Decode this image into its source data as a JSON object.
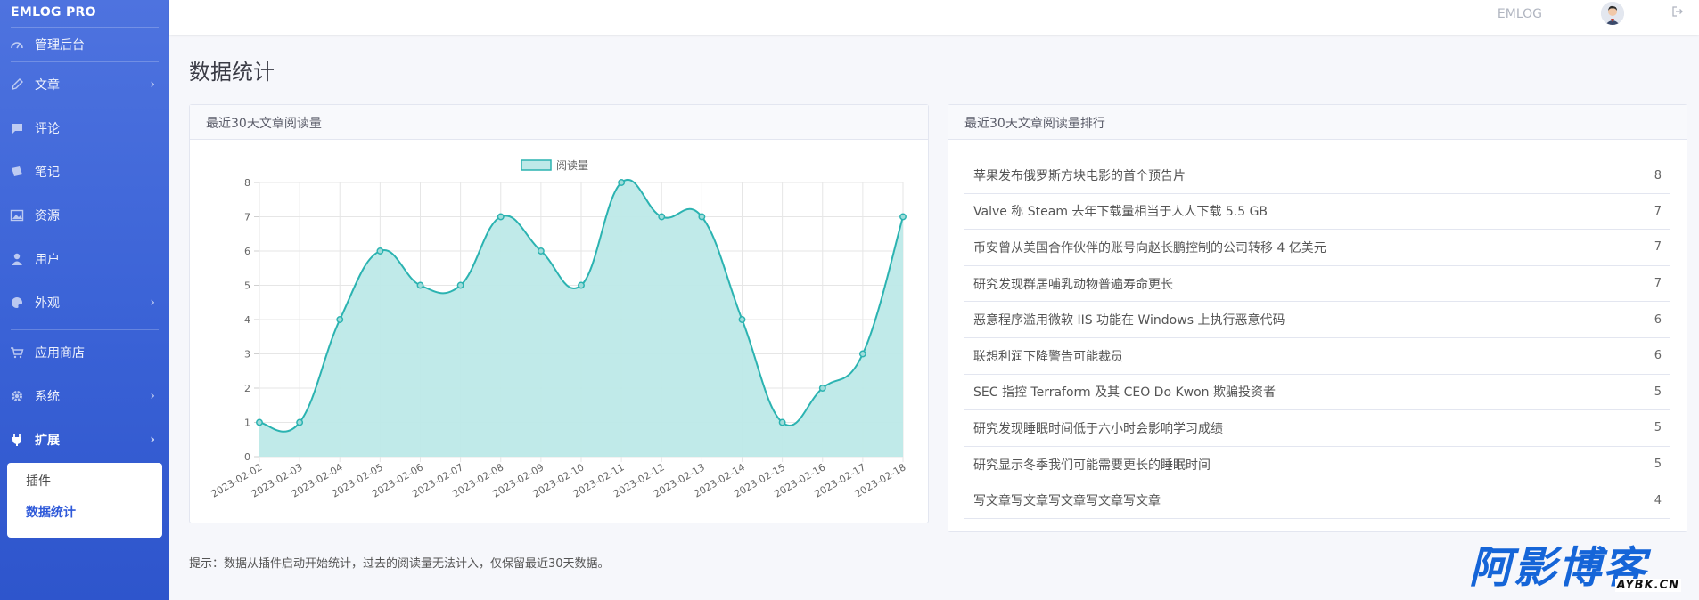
{
  "app": {
    "brand": "EMLOG PRO",
    "site_name": "EMLOG"
  },
  "sidebar": {
    "items": [
      {
        "label": "管理后台",
        "icon": "dashboard-icon",
        "chevron": false,
        "bold": false
      },
      {
        "label": "文章",
        "icon": "pencil-icon",
        "chevron": true,
        "bold": false
      },
      {
        "label": "评论",
        "icon": "comment-icon",
        "chevron": false,
        "bold": false
      },
      {
        "label": "笔记",
        "icon": "sticky-note-icon",
        "chevron": false,
        "bold": false
      },
      {
        "label": "资源",
        "icon": "image-icon",
        "chevron": false,
        "bold": false
      },
      {
        "label": "用户",
        "icon": "user-icon",
        "chevron": false,
        "bold": false
      },
      {
        "label": "外观",
        "icon": "palette-icon",
        "chevron": true,
        "bold": false
      },
      {
        "label": "应用商店",
        "icon": "store-icon",
        "chevron": false,
        "bold": false
      },
      {
        "label": "系统",
        "icon": "gear-icon",
        "chevron": true,
        "bold": false
      },
      {
        "label": "扩展",
        "icon": "plug-icon",
        "chevron": true,
        "bold": true
      }
    ],
    "submenu": [
      {
        "label": "插件",
        "active": false
      },
      {
        "label": "数据统计",
        "active": true
      }
    ]
  },
  "main": {
    "title": "数据统计",
    "chart_card_title": "最近30天文章阅读量",
    "ranking_card_title": "最近30天文章阅读量排行",
    "tip": "提示：数据从插件启动开始统计，过去的阅读量无法计入，仅保留最近30天数据。"
  },
  "ranking": [
    {
      "title": "苹果发布俄罗斯方块电影的首个预告片",
      "count": "8"
    },
    {
      "title": "Valve 称 Steam 去年下载量相当于人人下载 5.5 GB",
      "count": "7"
    },
    {
      "title": "币安曾从美国合作伙伴的账号向赵长鹏控制的公司转移 4 亿美元",
      "count": "7"
    },
    {
      "title": "研究发现群居哺乳动物普遍寿命更长",
      "count": "7"
    },
    {
      "title": "恶意程序滥用微软 IIS 功能在 Windows 上执行恶意代码",
      "count": "6"
    },
    {
      "title": "联想利润下降警告可能裁员",
      "count": "6"
    },
    {
      "title": "SEC 指控 Terraform 及其 CEO Do Kwon 欺骗投资者",
      "count": "5"
    },
    {
      "title": "研究发现睡眠时间低于六小时会影响学习成绩",
      "count": "5"
    },
    {
      "title": "研究显示冬季我们可能需要更长的睡眠时间",
      "count": "5"
    },
    {
      "title": "写文章写文章写文章写文章写文章",
      "count": "4"
    }
  ],
  "chart_data": {
    "type": "area",
    "x": [
      "2023-02-02",
      "2023-02-03",
      "2023-02-04",
      "2023-02-05",
      "2023-02-06",
      "2023-02-07",
      "2023-02-08",
      "2023-02-09",
      "2023-02-10",
      "2023-02-11",
      "2023-02-12",
      "2023-02-13",
      "2023-02-14",
      "2023-02-15",
      "2023-02-16",
      "2023-02-17",
      "2023-02-18"
    ],
    "series": [
      {
        "name": "阅读量",
        "values": [
          1,
          1,
          4,
          6,
          5,
          5,
          7,
          6,
          5,
          8,
          7,
          7,
          4,
          1,
          2,
          3,
          7
        ]
      }
    ],
    "ylim": [
      0,
      8
    ],
    "yticks": [
      0,
      1,
      2,
      3,
      4,
      5,
      6,
      7,
      8
    ],
    "grid": true,
    "legend": "top",
    "colors": {
      "line": "#2bb3b1",
      "fill": "#bde9e8"
    }
  },
  "watermark": {
    "big": "阿影博客",
    "small": "AYBK.CN"
  }
}
